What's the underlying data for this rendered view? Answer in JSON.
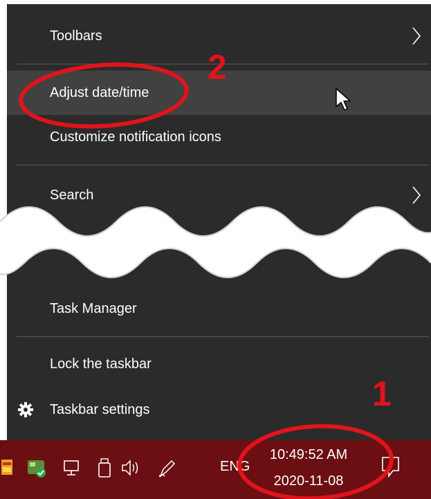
{
  "menu": {
    "items": [
      {
        "label": "Toolbars",
        "has_submenu": true
      },
      {
        "label": "Adjust date/time",
        "highlighted": true
      },
      {
        "label": "Customize notification icons"
      },
      {
        "label": "Search",
        "has_submenu": true
      },
      {
        "label": "Task Manager"
      },
      {
        "label": "Lock the taskbar"
      },
      {
        "label": "Taskbar settings",
        "icon": "gear-icon"
      }
    ]
  },
  "taskbar": {
    "language": "ENG",
    "clock": {
      "time": "10:49:52 AM",
      "date": "2020-11-08"
    },
    "tray_icons": [
      "app-icon",
      "network-shield-icon",
      "monitor-icon",
      "usb-icon",
      "volume-icon",
      "pen-icon"
    ],
    "notification_icon": "action-center-icon"
  },
  "annotations": {
    "marker_1": "1",
    "marker_2": "2"
  },
  "colors": {
    "menu_bg": "#2b2b2b",
    "menu_hover": "#414141",
    "taskbar_bg": "#6b0f12",
    "annotation": "#e0141b"
  }
}
